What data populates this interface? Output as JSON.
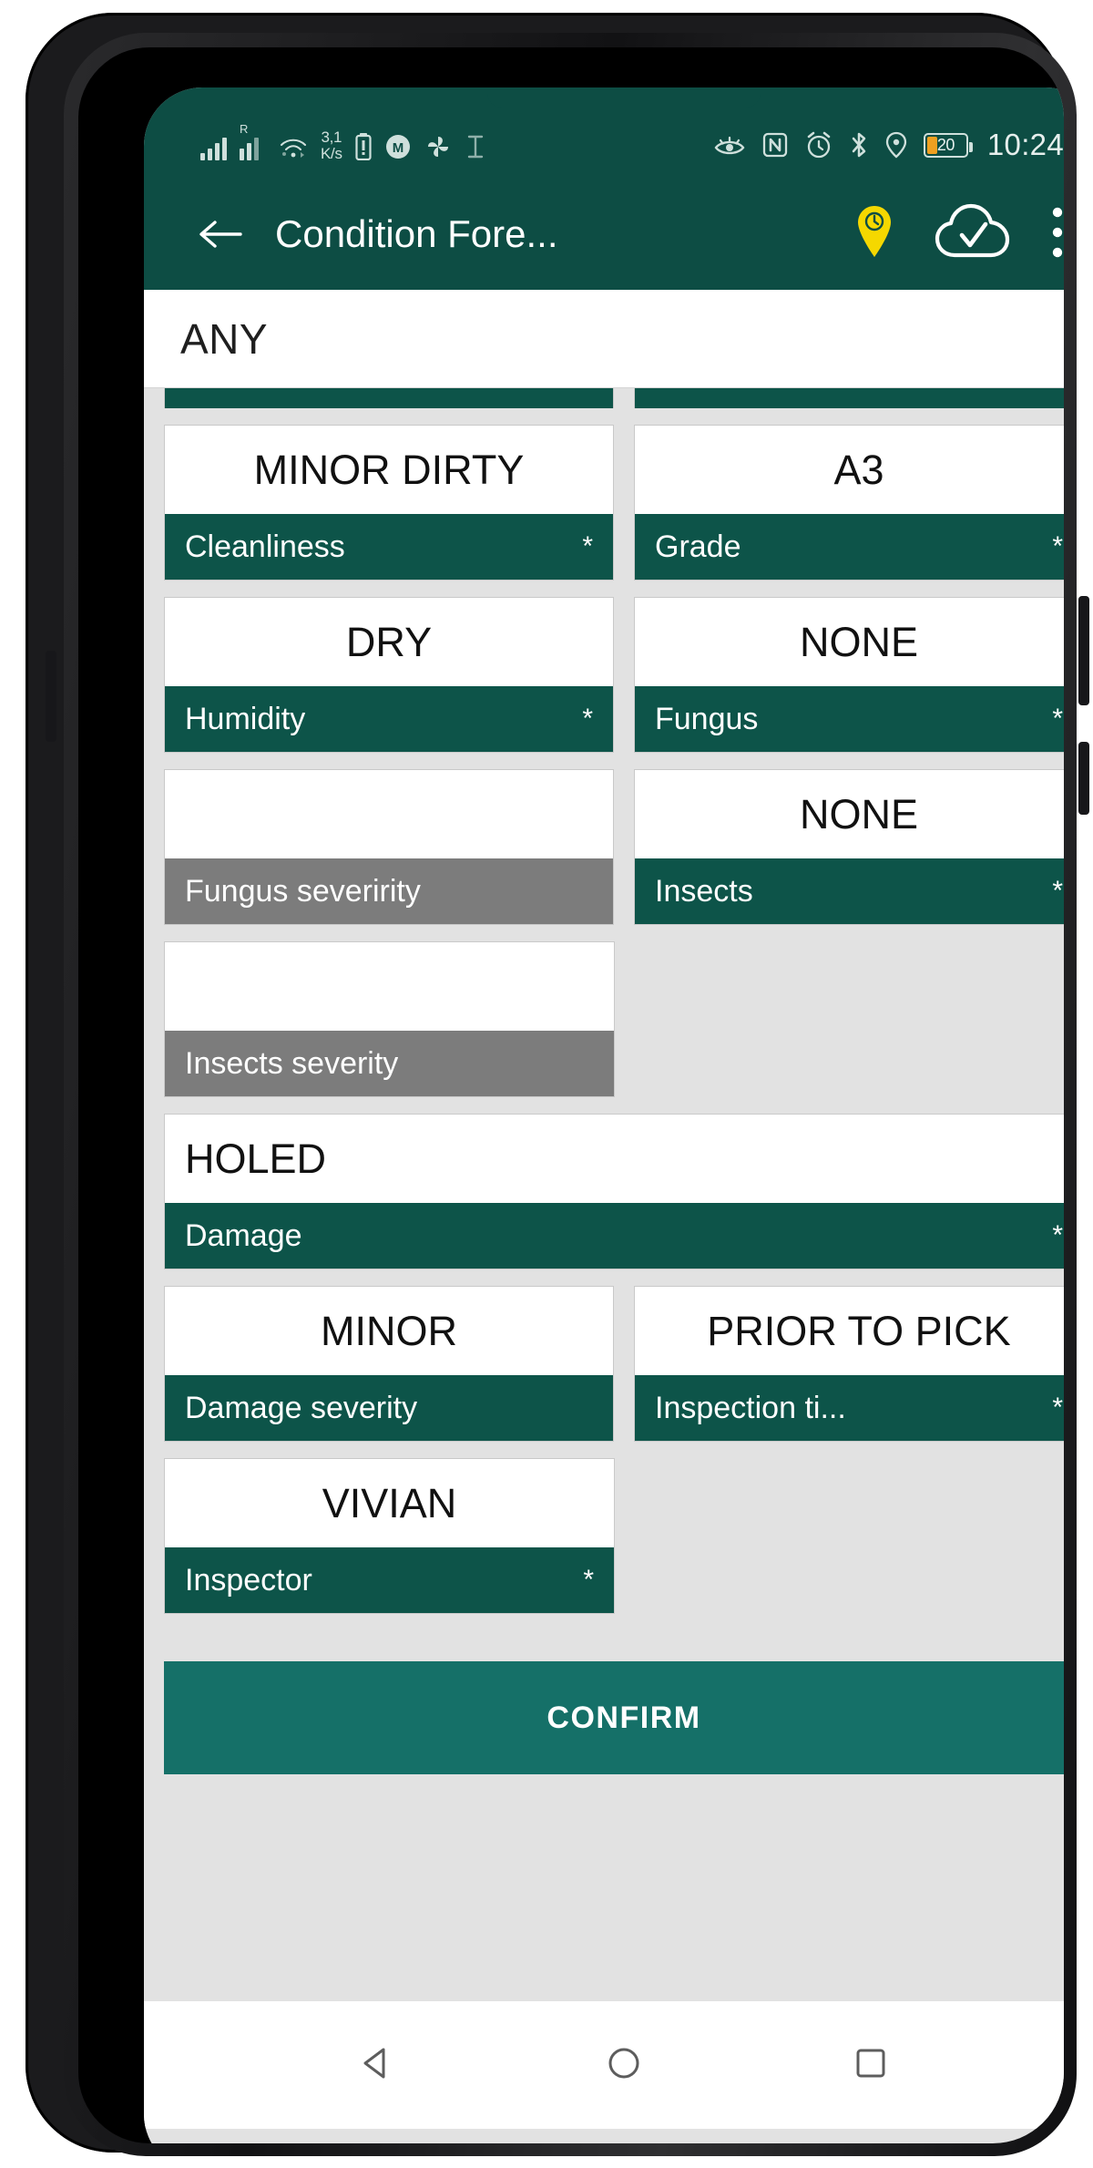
{
  "status_bar": {
    "network_speed": "3,1\nK/s",
    "network_speed_value": "3,1",
    "network_speed_unit": "K/s",
    "roaming_label": "R",
    "battery_percent": "20",
    "clock": "10:24",
    "icons": [
      "signal-bars-icon",
      "signal-bars-roaming-icon",
      "wifi-icon",
      "battery-alert-icon",
      "m-circle-icon",
      "pinwheel-icon",
      "text-cursor-icon",
      "eye-care-icon",
      "nfc-icon",
      "alarm-icon",
      "bluetooth-icon",
      "location-icon",
      "battery-icon"
    ]
  },
  "app_bar": {
    "title": "Condition Fore...",
    "back_label": "Back",
    "actions": [
      "location-clock-icon",
      "cloud-check-icon",
      "overflow-menu-icon"
    ]
  },
  "search": {
    "value": "ANY",
    "placeholder": "ANY"
  },
  "colors": {
    "primary_dark": "#0d4d44",
    "label_green": "#0d5449",
    "disabled_gray": "#7c7c7c",
    "confirm_teal": "#157068",
    "page_bg": "#e2e2e2",
    "accent_yellow": "#f5d800",
    "battery_orange": "#f0a020"
  },
  "form": {
    "partial_row": [
      {
        "ghost_value": "",
        "align": "left"
      },
      {
        "ghost_value": "",
        "align": "center"
      }
    ],
    "rows": [
      {
        "fields": [
          {
            "value": "MINOR DIRTY",
            "label": "Cleanliness",
            "required": "*",
            "disabled": false,
            "align": "center",
            "width": "half"
          },
          {
            "value": "A3",
            "label": "Grade",
            "required": "*",
            "disabled": false,
            "align": "center",
            "width": "half"
          }
        ]
      },
      {
        "fields": [
          {
            "value": "DRY",
            "label": "Humidity",
            "required": "*",
            "disabled": false,
            "align": "center",
            "width": "half"
          },
          {
            "value": "NONE",
            "label": "Fungus",
            "required": "*",
            "disabled": false,
            "align": "center",
            "width": "half"
          }
        ]
      },
      {
        "fields": [
          {
            "value": "",
            "label": "Fungus severirity",
            "required": "",
            "disabled": true,
            "align": "center",
            "width": "half"
          },
          {
            "value": "NONE",
            "label": "Insects",
            "required": "*",
            "disabled": false,
            "align": "center",
            "width": "half"
          }
        ]
      },
      {
        "fields": [
          {
            "value": "",
            "label": "Insects severity",
            "required": "",
            "disabled": true,
            "align": "center",
            "width": "half"
          },
          {
            "value": "",
            "label": "",
            "required": "",
            "disabled": false,
            "align": "center",
            "width": "blank"
          }
        ]
      },
      {
        "fields": [
          {
            "value": "HOLED",
            "label": "Damage",
            "required": "*",
            "disabled": false,
            "align": "left",
            "width": "full"
          }
        ]
      },
      {
        "fields": [
          {
            "value": "MINOR",
            "label": "Damage severity",
            "required": "",
            "disabled": false,
            "align": "center",
            "width": "half"
          },
          {
            "value": "PRIOR TO PICK",
            "label": "Inspection ti...",
            "required": "*",
            "disabled": false,
            "align": "center",
            "width": "half"
          }
        ]
      },
      {
        "fields": [
          {
            "value": "VIVIAN",
            "label": "Inspector",
            "required": "*",
            "disabled": false,
            "align": "center",
            "width": "half"
          },
          {
            "value": "",
            "label": "",
            "required": "",
            "disabled": false,
            "align": "center",
            "width": "blank"
          }
        ]
      }
    ],
    "confirm_label": "CONFIRM"
  },
  "nav_bar": {
    "items": [
      "back-triangle-icon",
      "home-circle-icon",
      "recents-square-icon"
    ]
  }
}
